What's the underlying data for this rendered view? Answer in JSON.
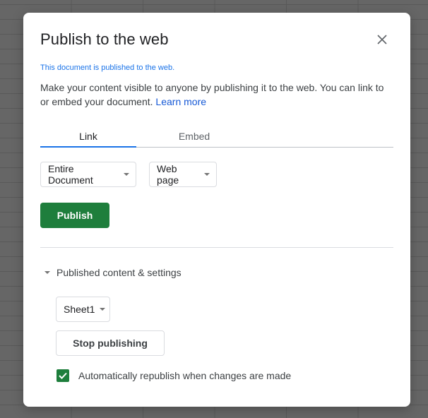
{
  "dialog": {
    "title": "Publish to the web",
    "close_icon": "close-icon",
    "status_text": "This document is published to the web.",
    "description": "Make your content visible to anyone by publishing it to the web. You can link to or embed your document.",
    "learn_more_label": "Learn more",
    "tabs": [
      {
        "label": "Link",
        "active": true
      },
      {
        "label": "Embed",
        "active": false
      }
    ],
    "scope_select": {
      "value": "Entire Document",
      "icon": "caret-down-icon"
    },
    "format_select": {
      "value": "Web page",
      "icon": "caret-down-icon"
    },
    "publish_button_label": "Publish",
    "settings_section": {
      "header": "Published content & settings",
      "expanded": true,
      "sheet_select": {
        "value": "Sheet1",
        "icon": "caret-down-icon"
      },
      "stop_button_label": "Stop publishing",
      "auto_republish": {
        "label": "Automatically republish when changes are made",
        "checked": true
      }
    }
  },
  "colors": {
    "accent_blue": "#1a73e8",
    "primary_green": "#1e7e3c",
    "text_primary": "#202124",
    "text_secondary": "#3c4043"
  }
}
